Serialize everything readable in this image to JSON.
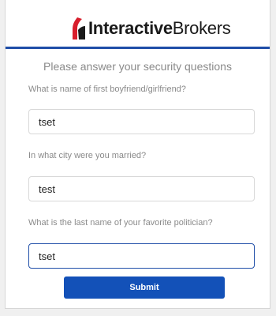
{
  "brand": {
    "name_bold": "Interactive",
    "name_light": "Brokers",
    "mark_color": "#d81e2c",
    "accent_color": "#1f4ea8"
  },
  "form": {
    "heading": "Please answer your security questions",
    "questions": [
      {
        "label": "What is name of first boyfriend/girlfriend?",
        "value": "tset"
      },
      {
        "label": "In what city were you married?",
        "value": "test"
      },
      {
        "label": "What is the last name of your favorite politician?",
        "value": "tset"
      }
    ],
    "submit_label": "Submit",
    "submit_color": "#1351b8"
  }
}
